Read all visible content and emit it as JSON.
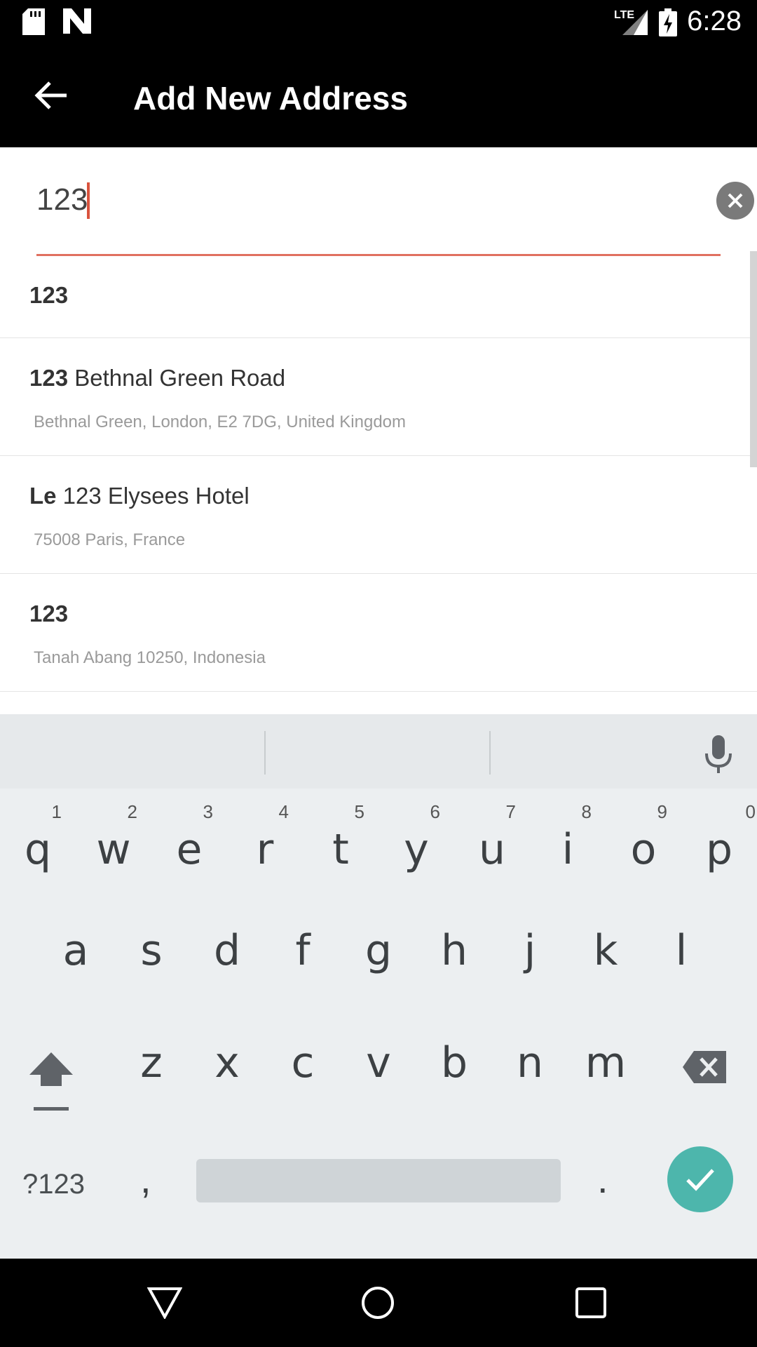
{
  "status_bar": {
    "time": "6:28",
    "network": "LTE",
    "icons": [
      "sd-card-icon",
      "n-logo-icon",
      "signal-icon",
      "battery-charging-icon"
    ]
  },
  "app_bar": {
    "title": "Add New Address",
    "back_icon": "arrow-left-icon"
  },
  "search": {
    "value": "123",
    "clear_icon": "clear-circle-icon",
    "accent_color": "#e07060"
  },
  "results": [
    {
      "bold": "123",
      "main": "",
      "sub": ""
    },
    {
      "bold": "123",
      "main": " Bethnal Green Road",
      "sub": "Bethnal Green, London, E2 7DG, United Kingdom"
    },
    {
      "bold": "Le",
      "main": " 123 Elysees Hotel",
      "sub": "75008 Paris, France"
    },
    {
      "bold": "123",
      "main": "",
      "sub": "Tanah Abang 10250, Indonesia"
    }
  ],
  "keyboard": {
    "row1": [
      {
        "letter": "q",
        "hint": "1"
      },
      {
        "letter": "w",
        "hint": "2"
      },
      {
        "letter": "e",
        "hint": "3"
      },
      {
        "letter": "r",
        "hint": "4"
      },
      {
        "letter": "t",
        "hint": "5"
      },
      {
        "letter": "y",
        "hint": "6"
      },
      {
        "letter": "u",
        "hint": "7"
      },
      {
        "letter": "i",
        "hint": "8"
      },
      {
        "letter": "o",
        "hint": "9"
      },
      {
        "letter": "p",
        "hint": "0"
      }
    ],
    "row2": [
      "a",
      "s",
      "d",
      "f",
      "g",
      "h",
      "j",
      "k",
      "l"
    ],
    "row3": [
      "z",
      "x",
      "c",
      "v",
      "b",
      "n",
      "m"
    ],
    "symbols_label": "?123",
    "comma": ",",
    "period": ".",
    "done_color": "#4db6ac"
  },
  "nav_bar": {
    "icons": [
      "nav-back-icon",
      "nav-home-icon",
      "nav-recents-icon"
    ]
  }
}
